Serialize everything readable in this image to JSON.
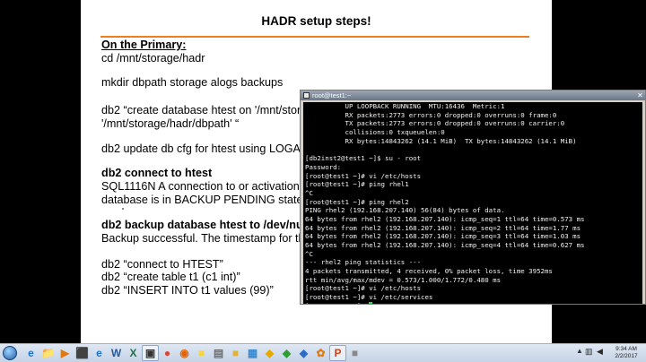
{
  "slide": {
    "title": "HADR setup steps!",
    "lines": [
      {
        "text": "On the Primary:",
        "style": "bold-underline"
      },
      {
        "text": "cd /mnt/storage/hadr",
        "style": "normal"
      },
      {
        "text": "mkdir dbpath  storage  alogs  backups",
        "style": "normal"
      },
      {
        "text": "db2  “create database htest on '/mnt/stora",
        "style": "normal"
      },
      {
        "text": "'/mnt/storage/hadr/dbpath' “",
        "style": "normal"
      },
      {
        "text": "db2 update db cfg for htest using LOGAR",
        "style": "normal"
      },
      {
        "text": "db2 connect to htest",
        "style": "bold"
      },
      {
        "text": "SQL1116N  A connection to or activation o",
        "style": "normal"
      },
      {
        "text": "database is in BACKUP PENDING state.",
        "style": "normal"
      },
      {
        "text": "db2 backup database htest to /dev/null",
        "style": "bold"
      },
      {
        "text": "Backup successful. The timestamp for this",
        "style": "normal"
      },
      {
        "text": "db2 “connect to HTEST”",
        "style": "normal"
      },
      {
        "text": "db2 “create table t1 (c1 int)”",
        "style": "normal"
      },
      {
        "text": "db2 “INSERT INTO t1 values (99)”",
        "style": "normal"
      }
    ]
  },
  "terminal": {
    "title": "root@test1:~",
    "lines": [
      "          UP LOOPBACK RUNNING  MTU:16436  Metric:1",
      "          RX packets:2773 errors:0 dropped:0 overruns:0 frame:0",
      "          TX packets:2773 errors:0 dropped:0 overruns:0 carrier:0",
      "          collisions:0 txqueuelen:0",
      "          RX bytes:14843262 (14.1 MiB)  TX bytes:14843262 (14.1 MiB)",
      "",
      "[db2inst2@test1 ~]$ su - root",
      "Password:",
      "[root@test1 ~]# vi /etc/hosts",
      "[root@test1 ~]# ping rhel1",
      "^C",
      "[root@test1 ~]# ping rhel2",
      "PING rhel2 (192.168.207.140) 56(84) bytes of data.",
      "64 bytes from rhel2 (192.168.207.140): icmp_seq=1 ttl=64 time=0.573 ms",
      "64 bytes from rhel2 (192.168.207.140): icmp_seq=2 ttl=64 time=1.77 ms",
      "64 bytes from rhel2 (192.168.207.140): icmp_seq=3 ttl=64 time=1.03 ms",
      "64 bytes from rhel2 (192.168.207.140): icmp_seq=4 ttl=64 time=0.627 ms",
      "^C",
      "--- rhel2 ping statistics ---",
      "4 packets transmitted, 4 received, 0% packet loss, time 3952ms",
      "rtt min/avg/max/mdev = 0.573/1.000/1.772/0.480 ms",
      "[root@test1 ~]# vi /etc/hosts",
      "[root@test1 ~]# vi /etc/services",
      "[root@test1 ~]# "
    ]
  },
  "taskbar": {
    "apps": [
      {
        "name": "ie",
        "glyph": "e",
        "color": "#1e73c8"
      },
      {
        "name": "explorer",
        "glyph": "📁",
        "color": "#d9a21b"
      },
      {
        "name": "media-player",
        "glyph": "▶",
        "color": "#e07a10"
      },
      {
        "name": "network",
        "glyph": "⬛",
        "color": "#3a6ea5"
      },
      {
        "name": "ie-2",
        "glyph": "e",
        "color": "#1e73c8"
      },
      {
        "name": "word",
        "glyph": "W",
        "color": "#2b579a"
      },
      {
        "name": "excel",
        "glyph": "X",
        "color": "#207245"
      },
      {
        "name": "terminal",
        "glyph": "▣",
        "color": "#333333"
      },
      {
        "name": "chrome",
        "glyph": "●",
        "color": "#db4437"
      },
      {
        "name": "firefox",
        "glyph": "◉",
        "color": "#e66000"
      },
      {
        "name": "sticky-notes",
        "glyph": "■",
        "color": "#f3d54a"
      },
      {
        "name": "vmware",
        "glyph": "▤",
        "color": "#6d6d6d"
      },
      {
        "name": "folder",
        "glyph": "■",
        "color": "#e0b040"
      },
      {
        "name": "screen-tool",
        "glyph": "▦",
        "color": "#3a8ad0"
      },
      {
        "name": "app-yellow",
        "glyph": "◆",
        "color": "#e8a800"
      },
      {
        "name": "app-green",
        "glyph": "◆",
        "color": "#2e9e2e"
      },
      {
        "name": "app-blue",
        "glyph": "◆",
        "color": "#2a6ec7"
      },
      {
        "name": "app-orange",
        "glyph": "✿",
        "color": "#e07a10"
      },
      {
        "name": "powerpoint",
        "glyph": "P",
        "color": "#d04423"
      },
      {
        "name": "unknown-app",
        "glyph": "■",
        "color": "#888888"
      }
    ],
    "clock_time": "9:34 AM",
    "clock_date": "2/2/2017"
  }
}
